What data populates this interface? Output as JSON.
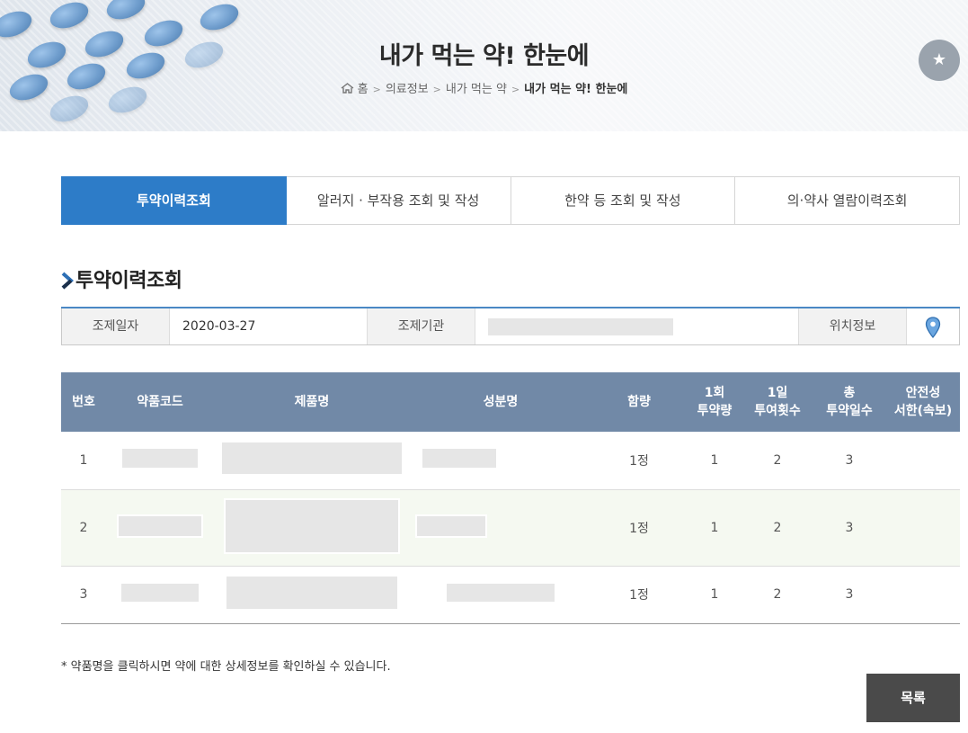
{
  "header": {
    "title": "내가 먹는 약! 한눈에",
    "breadcrumb": [
      "홈",
      "의료정보",
      "내가 먹는 약",
      "내가 먹는 약! 한눈에"
    ],
    "favorite_icon": "★"
  },
  "tabs": [
    {
      "label": "투약이력조회",
      "active": true
    },
    {
      "label": "알러지 · 부작용 조회 및 작성",
      "active": false
    },
    {
      "label": "한약 등 조회 및 작성",
      "active": false
    },
    {
      "label": "의·약사 열람이력조회",
      "active": false
    }
  ],
  "section": {
    "title": "투약이력조회"
  },
  "info": {
    "date_label": "조제일자",
    "date_value": "2020-03-27",
    "institution_label": "조제기관",
    "location_label": "위치정보"
  },
  "table": {
    "headers": [
      "번호",
      "약품코드",
      "제품명",
      "성분명",
      "함량",
      "1회\n투약량",
      "1일\n투여횟수",
      "총\n투약일수",
      "안전성\n서한(속보)"
    ],
    "rows": [
      {
        "no": "1",
        "amount": "1정",
        "dose": "1",
        "daily": "2",
        "days": "3"
      },
      {
        "no": "2",
        "amount": "1정",
        "dose": "1",
        "daily": "2",
        "days": "3"
      },
      {
        "no": "3",
        "amount": "1정",
        "dose": "1",
        "daily": "2",
        "days": "3"
      }
    ]
  },
  "note": "* 약품명을 클릭하시면 약에 대한 상세정보를 확인하실 수 있습니다.",
  "list_button": "목록",
  "colors": {
    "accent": "#2d7cc8",
    "table_header": "#7189a7",
    "button_dark": "#4a4a4a"
  }
}
